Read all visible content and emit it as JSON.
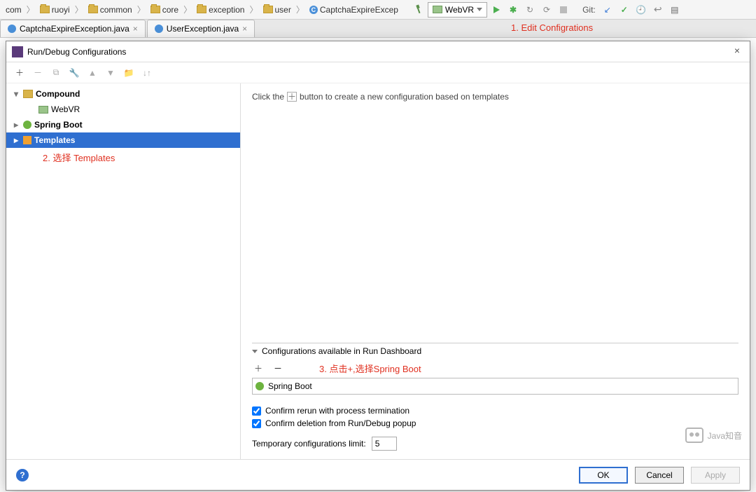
{
  "breadcrumb": [
    "com",
    "ruoyi",
    "common",
    "core",
    "exception",
    "user"
  ],
  "breadcrumb_last": "CaptchaExpireExcep",
  "run_config": "WebVR",
  "git_label": "Git:",
  "annotations": {
    "a1": "1. Edit Configrations",
    "a2": "2. 选择 Templates",
    "a3": "3. 点击+,选择Spring Boot"
  },
  "tabs": [
    {
      "label": "CaptchaExpireException.java"
    },
    {
      "label": "UserException.java"
    }
  ],
  "dialog": {
    "title": "Run/Debug Configurations",
    "close": "×",
    "tree": {
      "compound": "Compound",
      "webvr": "WebVR",
      "spring": "Spring Boot",
      "templates": "Templates"
    },
    "hint_pre": "Click the",
    "hint_post": "button to create a new configuration based on templates",
    "dash_title": "Configurations available in Run Dashboard",
    "dash_item": "Spring Boot",
    "chk1": "Confirm rerun with process termination",
    "chk2": "Confirm deletion from Run/Debug popup",
    "limit_label": "Temporary configurations limit:",
    "limit_value": "5",
    "ok": "OK",
    "cancel": "Cancel",
    "apply": "Apply"
  },
  "watermark": "Java知音"
}
